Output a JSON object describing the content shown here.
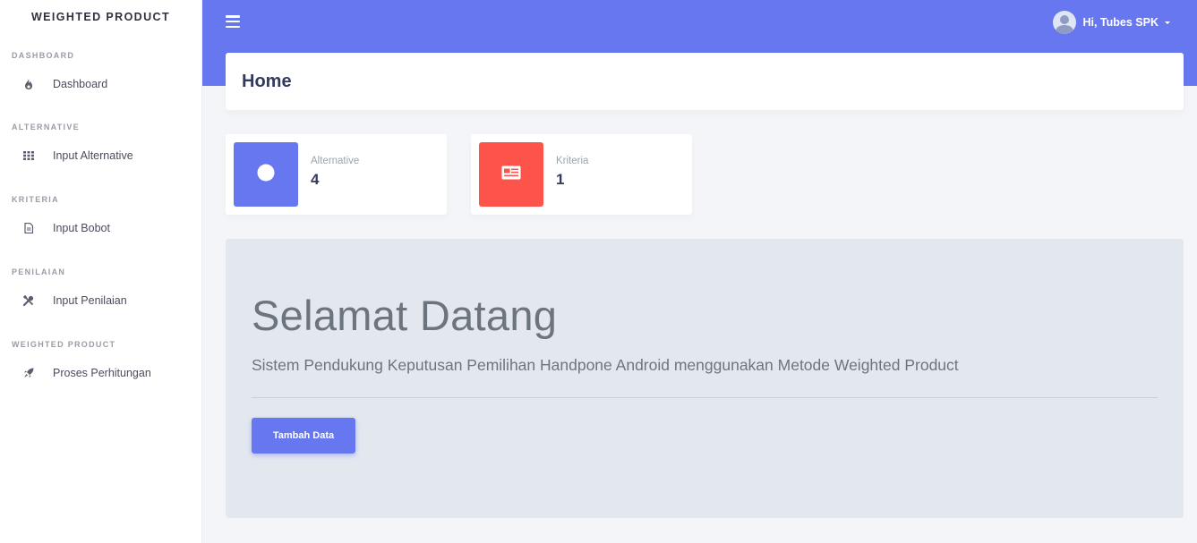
{
  "sidebar": {
    "brand": "WEIGHTED PRODUCT",
    "sections": [
      {
        "header": "DASHBOARD",
        "item": {
          "label": "Dashboard",
          "icon": "fire-icon"
        }
      },
      {
        "header": "ALTERNATIVE",
        "item": {
          "label": "Input Alternative",
          "icon": "grid-icon"
        }
      },
      {
        "header": "KRITERIA",
        "item": {
          "label": "Input Bobot",
          "icon": "file-icon"
        }
      },
      {
        "header": "PENILAIAN",
        "item": {
          "label": "Input Penilaian",
          "icon": "tools-icon"
        }
      },
      {
        "header": "WEIGHTED PRODUCT",
        "item": {
          "label": "Proses Perhitungan",
          "icon": "rocket-icon"
        }
      }
    ]
  },
  "topbar": {
    "user_name": "Hi, Tubes SPK"
  },
  "page": {
    "title": "Home"
  },
  "stats": [
    {
      "label": "Alternative",
      "value": "4",
      "color": "#6777ef",
      "icon": "circle-icon"
    },
    {
      "label": "Kriteria",
      "value": "1",
      "color": "#fc544b",
      "icon": "newspaper-icon"
    }
  ],
  "jumbotron": {
    "heading": "Selamat Datang",
    "lead": "Sistem Pendukung Keputusan Pemilihan Handpone Android menggunakan Metode Weighted Product",
    "button_label": "Tambah Data"
  },
  "colors": {
    "primary": "#6777ef",
    "danger": "#fc544b",
    "jumbotron_bg": "#e3e8ef"
  }
}
